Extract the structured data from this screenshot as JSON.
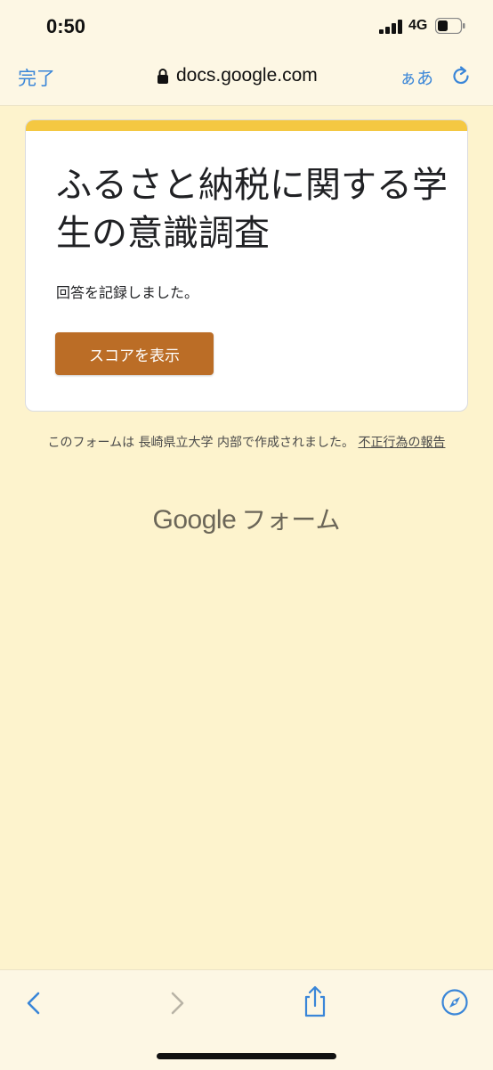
{
  "status_bar": {
    "time": "0:50",
    "network": "4G"
  },
  "browser": {
    "done_label": "完了",
    "url": "docs.google.com",
    "text_size_label": "ぁあ"
  },
  "form": {
    "title": "ふるさと納税に関する学生の意識調査",
    "confirmation": "回答を記録しました。",
    "score_button": "スコアを表示"
  },
  "footer": {
    "note": "このフォームは 長崎県立大学 内部で作成されました。",
    "report_link": "不正行為の報告",
    "brand_google": "Google",
    "brand_forms": "フォーム"
  },
  "colors": {
    "page_background": "#fdf3cd",
    "accent": "#f4c842",
    "button": "#bb6d26",
    "link": "#3a86d8"
  },
  "icons": [
    "signal-icon",
    "battery-icon",
    "lock-icon",
    "reload-icon",
    "back-icon",
    "forward-icon",
    "share-icon",
    "compass-icon"
  ]
}
